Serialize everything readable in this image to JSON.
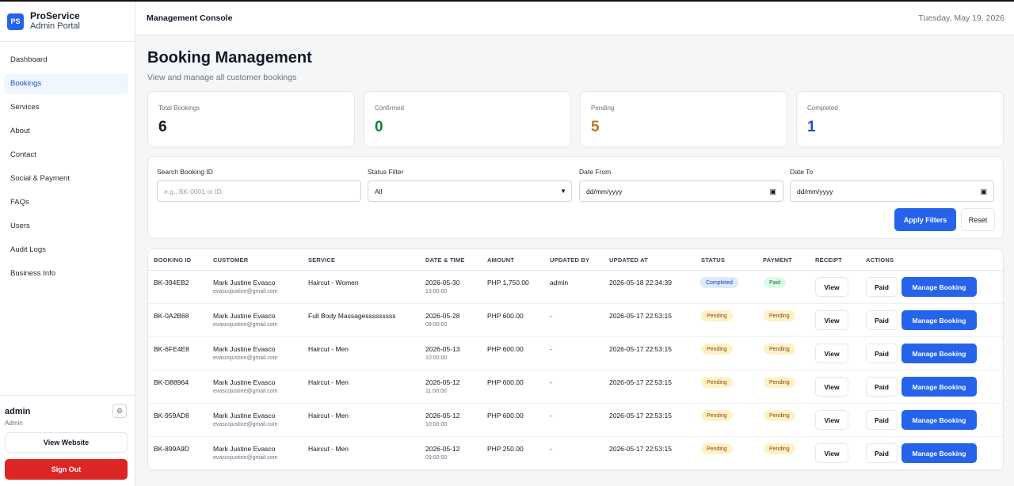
{
  "brand": {
    "logo": "PS",
    "name": "ProService",
    "subtitle": "Admin Portal"
  },
  "sidebar": {
    "items": [
      {
        "label": "Dashboard",
        "active": false
      },
      {
        "label": "Bookings",
        "active": true
      },
      {
        "label": "Services",
        "active": false
      },
      {
        "label": "About",
        "active": false
      },
      {
        "label": "Contact",
        "active": false
      },
      {
        "label": "Social & Payment",
        "active": false
      },
      {
        "label": "FAQs",
        "active": false
      },
      {
        "label": "Users",
        "active": false
      },
      {
        "label": "Audit Logs",
        "active": false
      },
      {
        "label": "Business Info",
        "active": false
      }
    ],
    "user": {
      "name": "admin",
      "role": "Admin",
      "settings_icon": "gear-icon"
    },
    "view_website": "View Website",
    "sign_out": "Sign Out"
  },
  "header": {
    "title": "Management Console",
    "date": "Tuesday, May 19, 2026"
  },
  "page": {
    "title": "Booking Management",
    "subtitle": "View and manage all customer bookings"
  },
  "stats": [
    {
      "label": "Total Bookings",
      "value": "6",
      "color": "#111827"
    },
    {
      "label": "Confirmed",
      "value": "0",
      "color": "#15803d"
    },
    {
      "label": "Pending",
      "value": "5",
      "color": "#b7791f"
    },
    {
      "label": "Completed",
      "value": "1",
      "color": "#1d4ed8"
    }
  ],
  "filters": {
    "search_label": "Search Booking ID",
    "search_placeholder": "e.g., BK-0001 or ID",
    "status_label": "Status Filter",
    "status_value": "All",
    "date_from_label": "Date From",
    "date_from_value": "dd/mm/yyyy",
    "date_to_label": "Date To",
    "date_to_value": "dd/mm/yyyy",
    "apply": "Apply Filters",
    "reset": "Reset"
  },
  "table": {
    "headers": [
      "BOOKING ID",
      "CUSTOMER",
      "SERVICE",
      "DATE & TIME",
      "AMOUNT",
      "UPDATED BY",
      "UPDATED AT",
      "STATUS",
      "PAYMENT",
      "RECEIPT",
      "ACTIONS"
    ],
    "rows": [
      {
        "id": "BK-394EB2",
        "customer": "Mark Justine Evasco",
        "email": "evascojustine@gmail.com",
        "service": "Haircut - Women",
        "date": "2026-05-30",
        "time": "13:00:00",
        "amount": "PHP 1,750.00",
        "updated_by": "admin",
        "updated_at": "2026-05-18 22:34:39",
        "status": "Completed",
        "payment": "Paid",
        "receipt": "View",
        "paid_btn": "Paid",
        "manage": "Manage Booking"
      },
      {
        "id": "BK-0A2B68",
        "customer": "Mark Justine Evasco",
        "email": "evascojustine@gmail.com",
        "service": "Full Body Massagesssssssss",
        "date": "2026-05-28",
        "time": "09:00:00",
        "amount": "PHP 600.00",
        "updated_by": "-",
        "updated_at": "2026-05-17 22:53:15",
        "status": "Pending",
        "payment": "Pending",
        "receipt": "View",
        "paid_btn": "Paid",
        "manage": "Manage Booking"
      },
      {
        "id": "BK-6FE4E8",
        "customer": "Mark Justine Evasco",
        "email": "evascojustine@gmail.com",
        "service": "Haircut - Men",
        "date": "2026-05-13",
        "time": "10:00:00",
        "amount": "PHP 600.00",
        "updated_by": "-",
        "updated_at": "2026-05-17 22:53:15",
        "status": "Pending",
        "payment": "Pending",
        "receipt": "View",
        "paid_btn": "Paid",
        "manage": "Manage Booking"
      },
      {
        "id": "BK-D88964",
        "customer": "Mark Justine Evasco",
        "email": "evascojustine@gmail.com",
        "service": "Haircut - Men",
        "date": "2026-05-12",
        "time": "11:00:00",
        "amount": "PHP 600.00",
        "updated_by": "-",
        "updated_at": "2026-05-17 22:53:15",
        "status": "Pending",
        "payment": "Pending",
        "receipt": "View",
        "paid_btn": "Paid",
        "manage": "Manage Booking"
      },
      {
        "id": "BK-959AD8",
        "customer": "Mark Justine Evasco",
        "email": "evascojustine@gmail.com",
        "service": "Haircut - Men",
        "date": "2026-05-12",
        "time": "10:00:00",
        "amount": "PHP 600.00",
        "updated_by": "-",
        "updated_at": "2026-05-17 22:53:15",
        "status": "Pending",
        "payment": "Pending",
        "receipt": "View",
        "paid_btn": "Paid",
        "manage": "Manage Booking"
      },
      {
        "id": "BK-899A9D",
        "customer": "Mark Justine Evasco",
        "email": "evascojustine@gmail.com",
        "service": "Haircut - Men",
        "date": "2026-05-12",
        "time": "09:00:00",
        "amount": "PHP 250.00",
        "updated_by": "-",
        "updated_at": "2026-05-17 22:53:15",
        "status": "Pending",
        "payment": "Pending",
        "receipt": "View",
        "paid_btn": "Paid",
        "manage": "Manage Booking"
      }
    ]
  }
}
